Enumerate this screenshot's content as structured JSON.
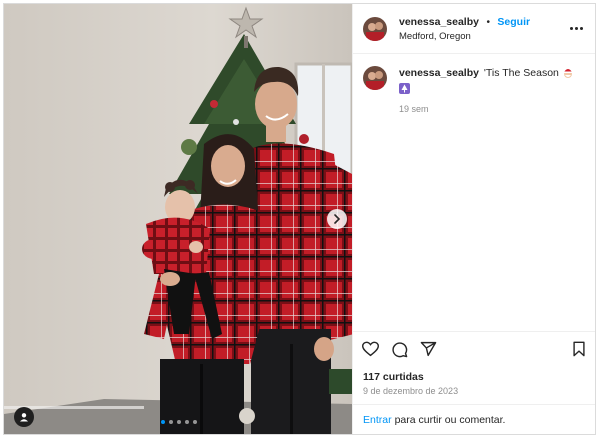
{
  "post": {
    "username": "venessa_sealby",
    "separator": "•",
    "follow_label": "Seguir",
    "location": "Medford, Oregon",
    "caption_text": "'Tis The Season",
    "time_ago": "19 sem",
    "likes": "117 curtidas",
    "date": "9 de dezembro de 2023",
    "login_prompt_link": "Entrar",
    "login_prompt_rest": "para curtir ou comentar."
  },
  "media": {
    "carousel_dots": 5,
    "active_dot": 0
  },
  "icons": {
    "more": "more-options-icon",
    "like": "heart-icon",
    "comment": "comment-icon",
    "share": "send-icon",
    "save": "bookmark-icon",
    "next": "chevron-right-icon",
    "tags": "user-tag-icon"
  },
  "colors": {
    "link_blue": "#0095f6",
    "text": "#262626",
    "muted": "#8e8e8e",
    "plaid_red": "#c8202b"
  }
}
